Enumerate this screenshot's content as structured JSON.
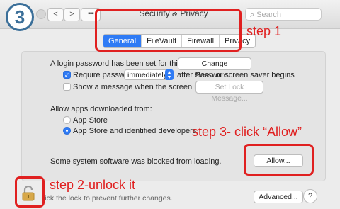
{
  "step_badge": "3",
  "window": {
    "title": "Security & Privacy",
    "nav_back": "<",
    "nav_forward": ">",
    "grid_icon": "grid-icon",
    "search_placeholder": "Search"
  },
  "tabs": [
    {
      "label": "General",
      "active": true
    },
    {
      "label": "FileVault",
      "active": false
    },
    {
      "label": "Firewall",
      "active": false
    },
    {
      "label": "Privacy",
      "active": false
    }
  ],
  "general": {
    "login_text": "A login password has been set for this user",
    "change_password": "Change Password...",
    "require_label": "Require password",
    "require_value": "immediately",
    "require_after": "after sleep or screen saver begins",
    "show_message_label": "Show a message when the screen is locked",
    "set_lock_message": "Set Lock Message...",
    "allow_apps_label": "Allow apps downloaded from:",
    "radio_app_store": "App Store",
    "radio_identified": "App Store and identified developers",
    "blocked_text": "Some system software was blocked from loading.",
    "allow_button": "Allow..."
  },
  "footer": {
    "lock_text": "lick the lock to prevent further changes.",
    "advanced_button": "Advanced...",
    "help_button": "?"
  },
  "annotations": {
    "step1": "step 1",
    "step2": "step 2-unlock it",
    "step3": "step 3- click “Allow”",
    "color": "#e02020"
  },
  "colors": {
    "accent": "#2f7bf5",
    "badge": "#3b6f99"
  }
}
